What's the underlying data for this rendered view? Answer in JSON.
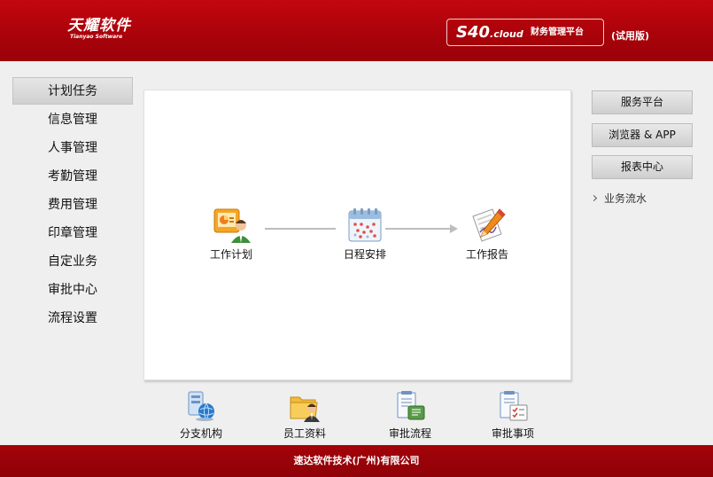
{
  "header": {
    "logo_main": "天耀软件",
    "logo_sub": "Tianyao Software",
    "product_name": "S40",
    "product_suffix": ".cloud",
    "product_desc": "财务管理平台",
    "trial_label": "(试用版)"
  },
  "nav": {
    "items": [
      {
        "label": "计划任务",
        "active": true
      },
      {
        "label": "信息管理"
      },
      {
        "label": "人事管理"
      },
      {
        "label": "考勤管理"
      },
      {
        "label": "费用管理"
      },
      {
        "label": "印章管理"
      },
      {
        "label": "自定业务"
      },
      {
        "label": "审批中心"
      },
      {
        "label": "流程设置"
      }
    ]
  },
  "flow": {
    "nodes": [
      {
        "label": "工作计划",
        "icon": "work-plan-icon"
      },
      {
        "label": "日程安排",
        "icon": "calendar-icon"
      },
      {
        "label": "工作报告",
        "icon": "work-report-icon"
      }
    ]
  },
  "quick_links": [
    {
      "label": "分支机构",
      "icon": "branch-icon"
    },
    {
      "label": "员工资料",
      "icon": "employee-folder-icon"
    },
    {
      "label": "审批流程",
      "icon": "approval-flow-icon"
    },
    {
      "label": "审批事项",
      "icon": "approval-items-icon"
    }
  ],
  "right": {
    "buttons": [
      "服务平台",
      "浏览器 & APP",
      "报表中心"
    ],
    "link": "业务流水"
  },
  "footer": {
    "text": "速达软件技术(广州)有限公司"
  },
  "colors": {
    "brand_red": "#b0030c",
    "footer_red": "#980208"
  }
}
